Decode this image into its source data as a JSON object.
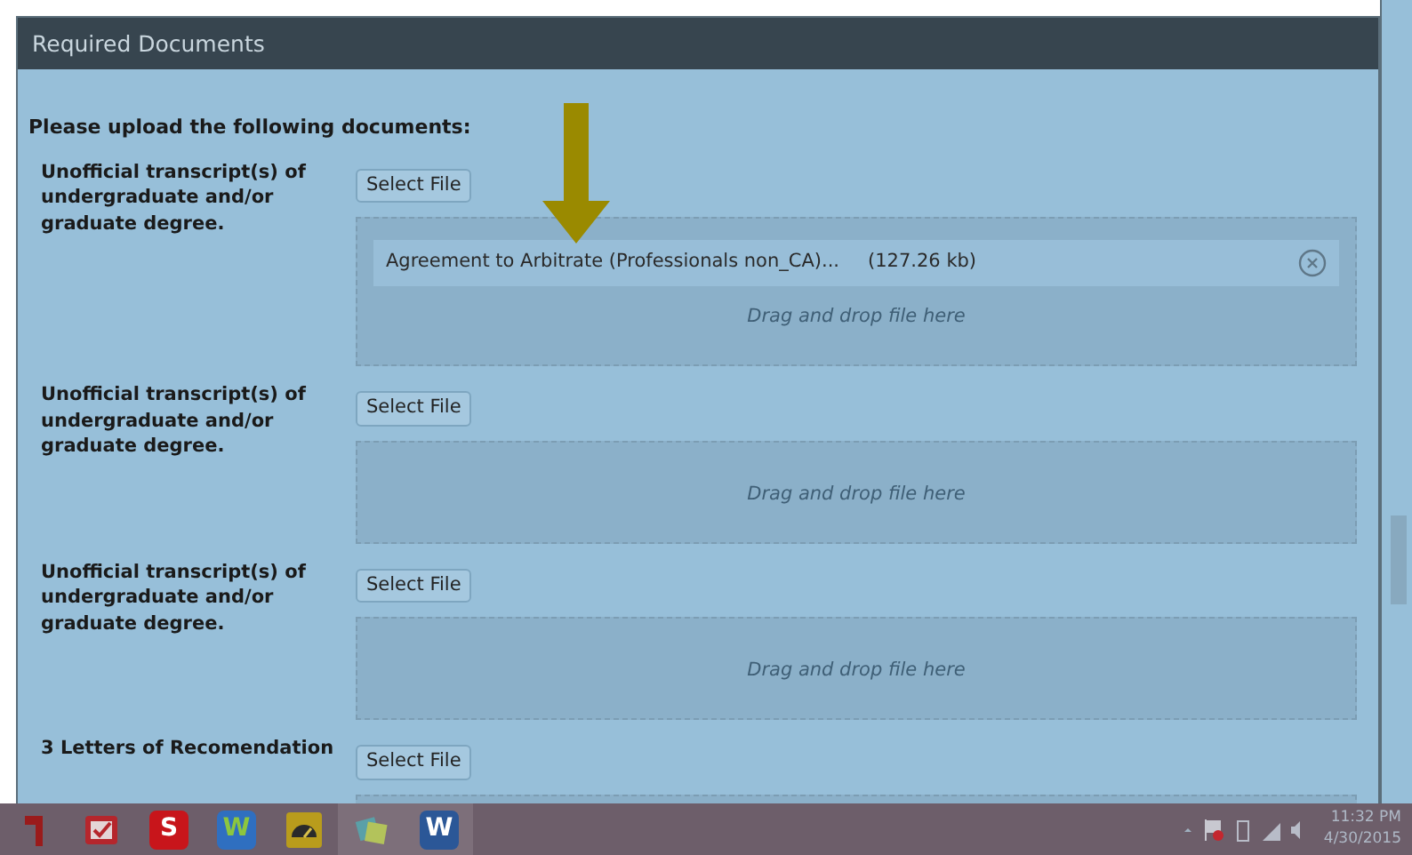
{
  "panel": {
    "title": "Required Documents",
    "instruction": "Please upload the following documents:"
  },
  "documents": [
    {
      "label": "Unofficial transcript(s) of undergraduate and/or graduate degree.",
      "button": "Select File",
      "files": [
        {
          "name": "Agreement to Arbitrate (Professionals non_CA)...",
          "size": "(127.26 kb)"
        }
      ],
      "hint": "Drag and drop file here"
    },
    {
      "label": "Unofficial transcript(s) of undergraduate and/or graduate degree.",
      "button": "Select File",
      "hint": "Drag and drop file here"
    },
    {
      "label": "Unofficial transcript(s) of undergraduate and/or graduate degree.",
      "button": "Select File",
      "hint": "Drag and drop file here"
    },
    {
      "label": "3 Letters of Recomendation",
      "button": "Select File"
    }
  ],
  "taskbar": {
    "apps": [
      {
        "kind": "partial",
        "selected": false
      },
      {
        "kind": "todo",
        "selected": false
      },
      {
        "kind": "speech",
        "glyph": "S",
        "selected": false
      },
      {
        "kind": "green-w",
        "glyph": "W",
        "selected": false
      },
      {
        "kind": "gauge",
        "selected": false
      },
      {
        "kind": "notes",
        "selected": true
      },
      {
        "kind": "word",
        "glyph": "W",
        "selected": true
      }
    ],
    "time": "11:32 PM",
    "date": "4/30/2015"
  }
}
